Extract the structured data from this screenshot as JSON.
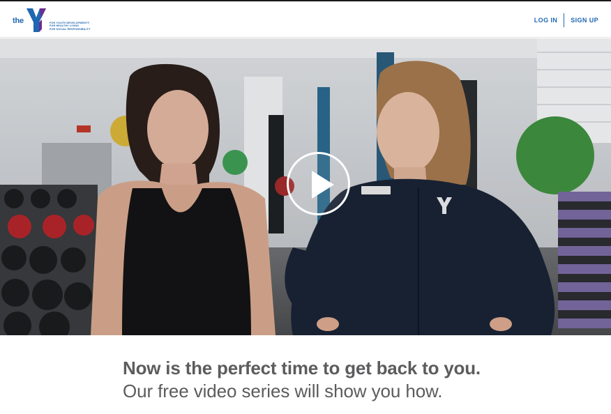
{
  "brand": {
    "logo_word": "the",
    "tagline": [
      "FOR YOUTH DEVELOPMENT®",
      "FOR HEALTHY LIVING",
      "FOR SOCIAL RESPONSIBILITY"
    ],
    "colors": {
      "blue": "#1f67b1",
      "purple": "#6b2c91",
      "text_gray": "#5c5c5e"
    }
  },
  "nav": {
    "login_label": "LOG IN",
    "signup_label": "SIGN UP"
  },
  "video": {
    "play_icon": "play-icon"
  },
  "promo": {
    "headline": "Now is the perfect time to get back to you.",
    "subline": "Our free video series will show you how."
  }
}
